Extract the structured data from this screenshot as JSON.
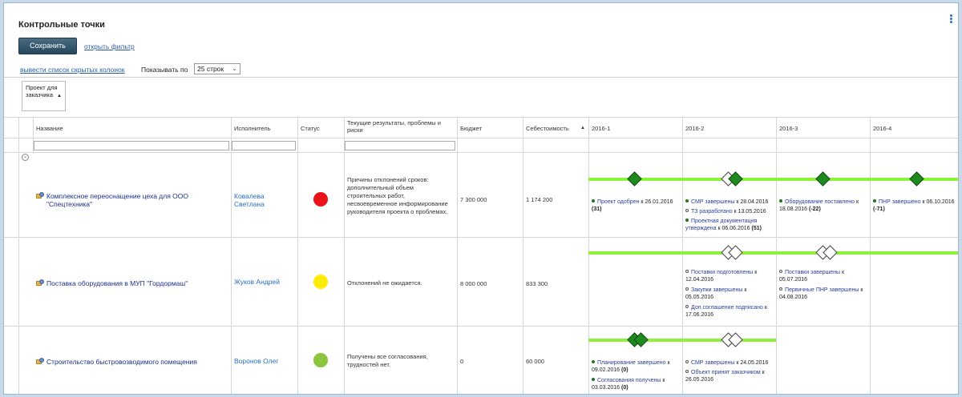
{
  "page": {
    "title": "Контрольные точки"
  },
  "toolbar": {
    "save_label": "Сохранить",
    "filter_link": "открыть фильтр",
    "hidden_columns_link": "вывести список скрытых колонок",
    "show_label": "Показывать по",
    "rows_selected": "25 строк"
  },
  "grouping": {
    "label": "Проект для заказчика"
  },
  "columns": {
    "name": "Название",
    "executor": "Исполнитель",
    "status": "Статус",
    "results": "Текущие результаты, проблемы и риски",
    "budget": "Бюджет",
    "cost": "Себестоимость",
    "q1": "2016-1",
    "q2": "2016-2",
    "q3": "2016-3",
    "q4": "2016-4"
  },
  "colors": {
    "status_red": "#e8141a",
    "status_yellow": "#ffee00",
    "status_green": "#8cc63f",
    "gantt_bar": "#8ef23a",
    "milestone_done": "#1f8a1f"
  },
  "rows": [
    {
      "name": "Комплексное переоснащение цеха для ООО \"Спецтехника\"",
      "executor": "Ковалева Светлана",
      "status": "red",
      "results": "Причины отклонений сроков: дополнительный объем строительных работ, несвоевременное информирование руководителя проекта о проблемах.",
      "budget": "7 300 000",
      "cost": "1 174 200",
      "milestones": {
        "q1": [
          {
            "label": "Проект одобрен",
            "date": "к 26.01.2016",
            "delta": "(31)",
            "done": true
          }
        ],
        "q2": [
          {
            "label": "СМР завершены",
            "date": "к 28.04.2016",
            "delta": "",
            "done": true
          },
          {
            "label": "ТЗ разработано",
            "date": "к 13.05.2016",
            "delta": "",
            "done": false
          },
          {
            "label": "Проектная документация утверждена",
            "date": "к 06.06.2016",
            "delta": "(51)",
            "done": true
          }
        ],
        "q3": [
          {
            "label": "Оборудование поставлено",
            "date": "к 18.08.2016",
            "delta": "(-22)",
            "done": true
          }
        ],
        "q4": [
          {
            "label": "ПНР завершено",
            "date": "к 06.10.2016",
            "delta": "(-71)",
            "done": true
          }
        ]
      }
    },
    {
      "name": "Поставка оборудования в МУП \"Гордормаш\"",
      "executor": "Жуков Андрей",
      "status": "yellow",
      "results": "Отклонений не ожидается.",
      "budget": "8 000 000",
      "cost": "833 300",
      "milestones": {
        "q2": [
          {
            "label": "Поставки подготовлены",
            "date": "к 12.04.2016",
            "delta": "",
            "done": false
          },
          {
            "label": "Закупки завершены",
            "date": "к 05.05.2016",
            "delta": "",
            "done": false
          },
          {
            "label": "Доп.соглашение подписано",
            "date": "к 17.06.2016",
            "delta": "",
            "done": false
          }
        ],
        "q3": [
          {
            "label": "Поставки завершены",
            "date": "к 05.07.2016",
            "delta": "",
            "done": false
          },
          {
            "label": "Первичные ПНР завершены",
            "date": "к 04.08.2016",
            "delta": "",
            "done": false
          }
        ]
      }
    },
    {
      "name": "Строительство быстровозводимого помещения",
      "executor": "Воронов Олег",
      "status": "green",
      "results": "Получены все согласования, трудностей нет.",
      "budget": "0",
      "cost": "60 000",
      "milestones": {
        "q1": [
          {
            "label": "Планирование завершено",
            "date": "к 09.02.2016",
            "delta": "(0)",
            "done": true
          },
          {
            "label": "Согласования получены",
            "date": "к 03.03.2016",
            "delta": "(0)",
            "done": true
          }
        ],
        "q2": [
          {
            "label": "СМР завершены",
            "date": "к 24.05.2016",
            "delta": "",
            "done": false
          },
          {
            "label": "Объект принят заказчиком",
            "date": "к 26.05.2016",
            "delta": "",
            "done": false
          }
        ]
      }
    }
  ]
}
